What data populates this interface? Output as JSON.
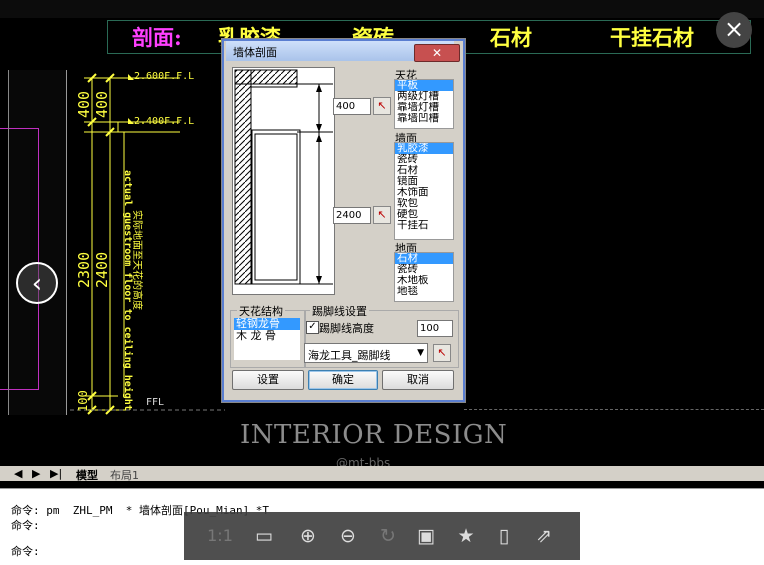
{
  "header": {
    "section_label": "剖面:",
    "item1": "乳胶漆",
    "item2": "瓷砖",
    "item3": "石材",
    "item4": "干挂石材"
  },
  "drawing": {
    "level_top": "2.600F.F.L",
    "level_mid": "2.400F.F.L",
    "level_floor": "FFL",
    "dim_400a": "400",
    "dim_400b": "400",
    "dim_2300": "2300",
    "dim_2400": "2400",
    "dim_100": "100",
    "vertical_note_en": "actual guestroom floor to ceiling height",
    "vertical_note_cn": "实际地面至天花的高度"
  },
  "dialog": {
    "title": "墙体剖面",
    "close_glyph": "✕",
    "ceiling_height_value": "400",
    "wall_height_value": "2400",
    "ceiling_list": {
      "header": "天花",
      "items": [
        "平板",
        "两级灯槽",
        "靠墙灯槽",
        "靠墙凹槽"
      ]
    },
    "wall_list": {
      "header": "墙面",
      "items": [
        "乳胶漆",
        "瓷砖",
        "石材",
        "镜面",
        "木饰面",
        "软包",
        "硬包",
        "干挂石"
      ]
    },
    "floor_list": {
      "header": "地面",
      "items": [
        "石材",
        "瓷砖",
        "木地板",
        "地毯"
      ]
    },
    "ceiling_structure": {
      "group_label": "天花结构",
      "items": [
        "轻钢龙骨",
        "木 龙 骨"
      ]
    },
    "skirting": {
      "group_label": "踢脚线设置",
      "checkbox_label": "踢脚线高度",
      "checked": true,
      "height_value": "100",
      "layer_select": "海龙工具_踢脚线"
    },
    "buttons": {
      "settings": "设置",
      "ok": "确定",
      "cancel": "取消"
    }
  },
  "watermark": {
    "line1": "INTERIOR DESIGN",
    "line2": "@mt-bbs"
  },
  "tabs": {
    "model": "模型",
    "layout": "布局1"
  },
  "command": {
    "line1": "命令: pm  ZHL_PM  * 墙体剖面[Pou_Mian] *T",
    "line2": "命令:",
    "line3": "命令:"
  },
  "viewer_toolbar": {
    "actual_size": "1:1"
  },
  "colors": {
    "header_yellow": "#ffff40",
    "header_magenta": "#ff40ff",
    "selection_blue": "#3399ff"
  }
}
